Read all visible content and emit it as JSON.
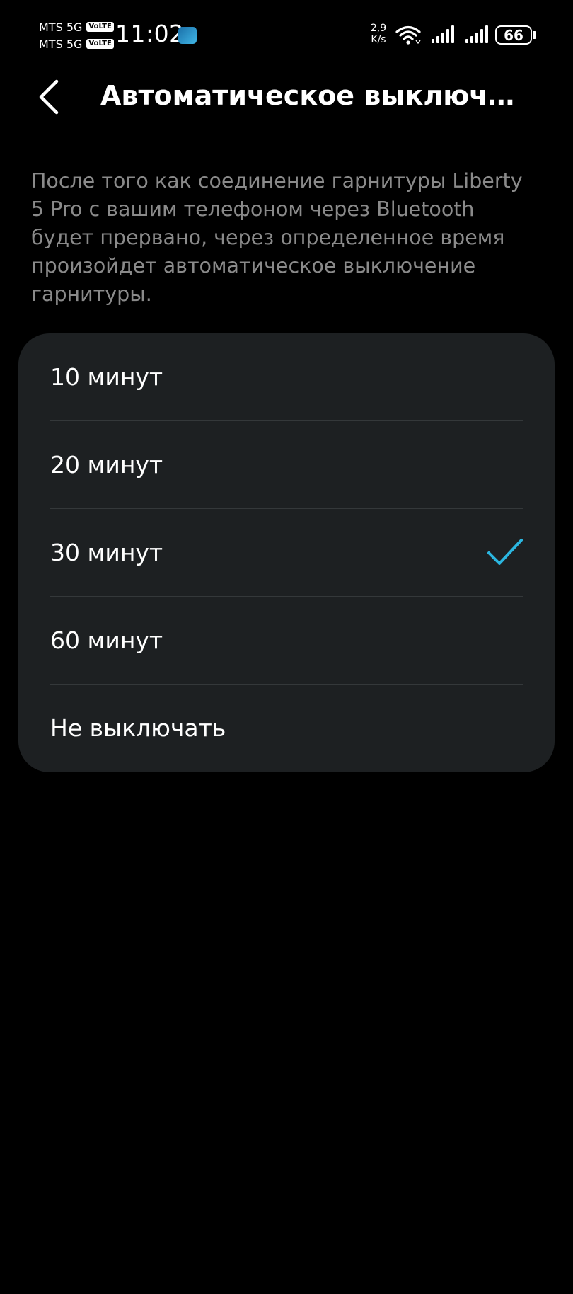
{
  "status_bar": {
    "carriers": [
      {
        "name": "MTS 5G",
        "badge": "VoLTE"
      },
      {
        "name": "MTS 5G",
        "badge": "VoLTE"
      }
    ],
    "time": "11:02",
    "net_speed_value": "2,9",
    "net_speed_unit": "K/s",
    "battery_level": "66",
    "icons": [
      "notification-app-icon",
      "wifi-icon",
      "signal-icon",
      "signal-icon",
      "battery-icon"
    ]
  },
  "header": {
    "back_icon": "chevron-left-icon",
    "title": "Автоматическое выключ…"
  },
  "description": "После того как соединение гарнитуры Liberty 5 Pro с вашим телефоном через Bluetooth будет прервано, через определенное время произойдет автоматическое выключение гарнитуры.",
  "options": [
    {
      "label": "10 минут",
      "selected": false
    },
    {
      "label": "20 минут",
      "selected": false
    },
    {
      "label": "30 минут",
      "selected": true
    },
    {
      "label": "60 минут",
      "selected": false
    },
    {
      "label": "Не выключать",
      "selected": false
    }
  ],
  "colors": {
    "background": "#000000",
    "card": "#1d2022",
    "accent": "#2bb6e0",
    "description_text": "#8a8a8a"
  }
}
